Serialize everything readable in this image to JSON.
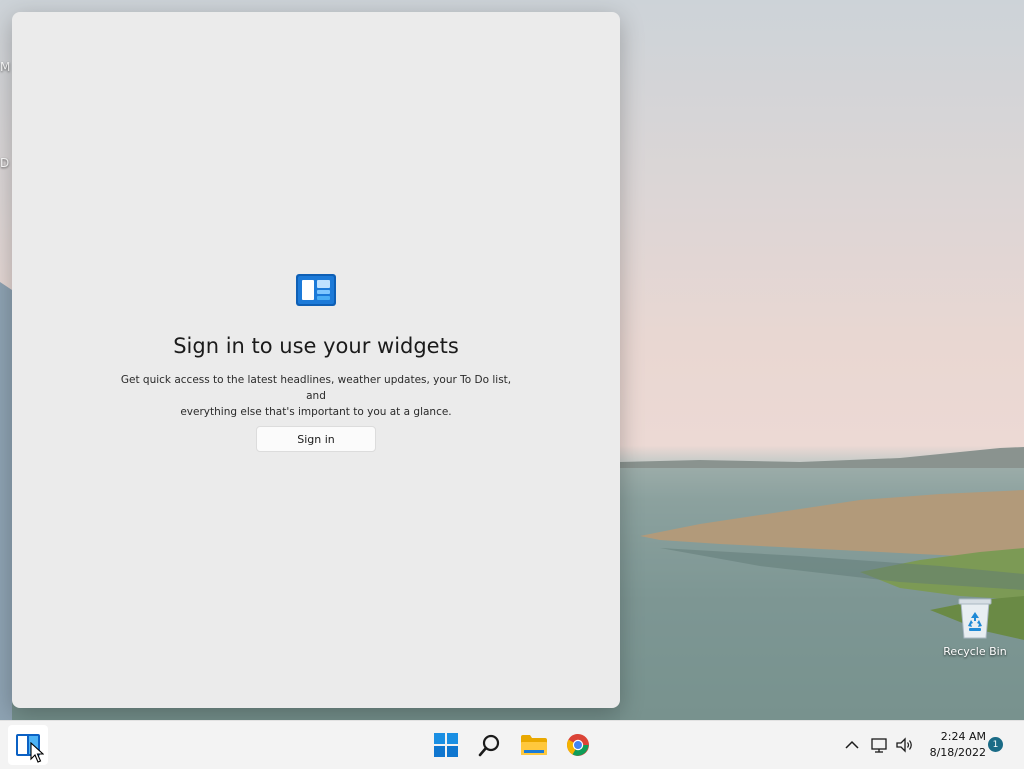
{
  "desktop": {
    "edge_labels": [
      "M",
      "D"
    ],
    "recycle_bin_label": "Recycle Bin"
  },
  "widgets_panel": {
    "logo_icon": "widgets-icon",
    "title": "Sign in to use your widgets",
    "description_line1": "Get quick access to the latest headlines, weather updates, your To Do list, and",
    "description_line2": "everything else that's important to you at a glance.",
    "signin_label": "Sign in"
  },
  "taskbar": {
    "items": [
      "widgets-icon",
      "start-icon",
      "search-icon",
      "file-explorer-icon",
      "chrome-icon"
    ],
    "tray": {
      "time": "2:24 AM",
      "date": "8/18/2022",
      "notification_count": "1",
      "icons": [
        "chevron-up-icon",
        "network-icon",
        "volume-icon"
      ]
    }
  },
  "colors": {
    "panel_bg": "#ebebeb",
    "taskbar_bg": "#f3f3f3",
    "accent_blue": "#0a78d4",
    "badge": "#1a6b86"
  }
}
